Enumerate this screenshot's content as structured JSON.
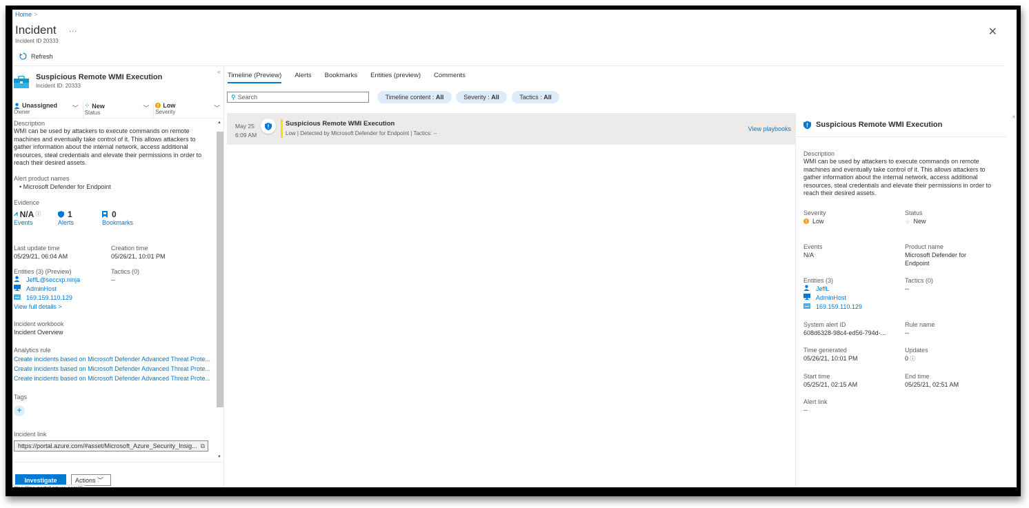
{
  "header": {
    "breadcrumb": [
      "Home"
    ],
    "title": "Incident",
    "more": "...",
    "subtitle": "Incident ID 20333",
    "refresh": "Refresh"
  },
  "incident": {
    "title": "Suspicious Remote WMI Execution",
    "id_label": "Incident ID: 20333",
    "owner": {
      "value": "Unassigned",
      "label": "Owner"
    },
    "status": {
      "value": "New",
      "label": "Status"
    },
    "severity": {
      "value": "Low",
      "label": "Severity"
    },
    "description_label": "Description",
    "description": "WMI can be used by attackers to execute commands on remote machines and eventually take control of it. This allows attackers to gather information about the internal network, access additional resources, steal credentials and elevate their permissions in order to reach their desired assets.",
    "alert_products_label": "Alert product names",
    "alert_products": [
      "Microsoft Defender for Endpoint"
    ],
    "evidence_label": "Evidence",
    "evidence": {
      "events": {
        "value": "N/A",
        "label": "Events"
      },
      "alerts": {
        "value": "1",
        "label": "Alerts"
      },
      "bookmarks": {
        "value": "0",
        "label": "Bookmarks"
      }
    },
    "last_update_label": "Last update time",
    "last_update": "05/29/21, 06:04 AM",
    "creation_label": "Creation time",
    "creation": "05/26/21, 10:01 PM",
    "entities_label": "Entities (3) (Preview)",
    "entities": [
      {
        "icon": "user-icon",
        "name": "JeffL@seccxp.ninja"
      },
      {
        "icon": "host-icon",
        "name": "AdminHost"
      },
      {
        "icon": "ip-icon",
        "name": "169.159.110.129"
      }
    ],
    "view_full_details": "View full details >",
    "tactics_label": "Tactics (0)",
    "tactics": "--",
    "workbook_label": "Incident workbook",
    "workbook": "Incident Overview",
    "analytics_label": "Analytics rule",
    "analytics_rules": [
      "Create incidents based on Microsoft Defender Advanced Threat Prote...",
      "Create incidents based on Microsoft Defender Advanced Threat Prote...",
      "Create incidents based on Microsoft Defender Advanced Threat Prote..."
    ],
    "tags_label": "Tags",
    "tags_add": "+",
    "link_label": "Incident link",
    "link": "https://portal.azure.com/#asset/Microsoft_Azure_Security_Insig...",
    "investigate": "Investigate",
    "actions": "Actions",
    "status_bar": "ttps://ms.portal.azure.com/#"
  },
  "tabs": [
    {
      "label": "Timeline (Preview)",
      "active": true
    },
    {
      "label": "Alerts"
    },
    {
      "label": "Bookmarks"
    },
    {
      "label": "Entities (preview)"
    },
    {
      "label": "Comments"
    }
  ],
  "filters": {
    "search_placeholder": "Search",
    "timeline_content": {
      "label": "Timeline content : ",
      "value": "All"
    },
    "severity": {
      "label": "Severity : ",
      "value": "All"
    },
    "tactics": {
      "label": "Tactics : ",
      "value": "All"
    }
  },
  "timeline": [
    {
      "date": "May 25",
      "time": "6:09 AM",
      "title": "Suspicious Remote WMI Execution",
      "subtitle": "Low | Detected by Microsoft Defender for Endpoint | Tactics: --",
      "action": "View playbooks",
      "severity_color": "#fce100"
    }
  ],
  "detail": {
    "title": "Suspicious Remote WMI Execution",
    "description_label": "Description",
    "description": "WMI can be used by attackers to execute commands on remote machines and eventually take control of it. This allows attackers to gather information about the internal network, access additional resources, steal credentials and elevate their permissions in order to reach their desired assets.",
    "severity_label": "Severity",
    "severity": "Low",
    "status_label": "Status",
    "status": "New",
    "events_label": "Events",
    "events": "N/A",
    "product_label": "Product name",
    "product": "Microsoft Defender for Endpoint",
    "entities_label": "Entities (3)",
    "entities": [
      "JeffL",
      "AdminHost",
      "169.159.110.129"
    ],
    "tactics_label": "Tactics (0)",
    "tactics": "--",
    "system_alert_id_label": "System alert ID",
    "system_alert_id": "608d6328-98c4-ed56-794d-...",
    "rule_name_label": "Rule name",
    "rule_name": "--",
    "time_generated_label": "Time generated",
    "time_generated": "05/26/21, 10:01 PM",
    "updates_label": "Updates",
    "updates": "0",
    "start_time_label": "Start time",
    "start_time": "05/25/21, 02:15 AM",
    "end_time_label": "End time",
    "end_time": "05/25/21, 02:51 AM",
    "alert_link_label": "Alert link",
    "alert_link": "--"
  },
  "colors": {
    "accent": "#0078d4",
    "severity_low": "#fce100",
    "pill_bg": "#deecf9"
  }
}
